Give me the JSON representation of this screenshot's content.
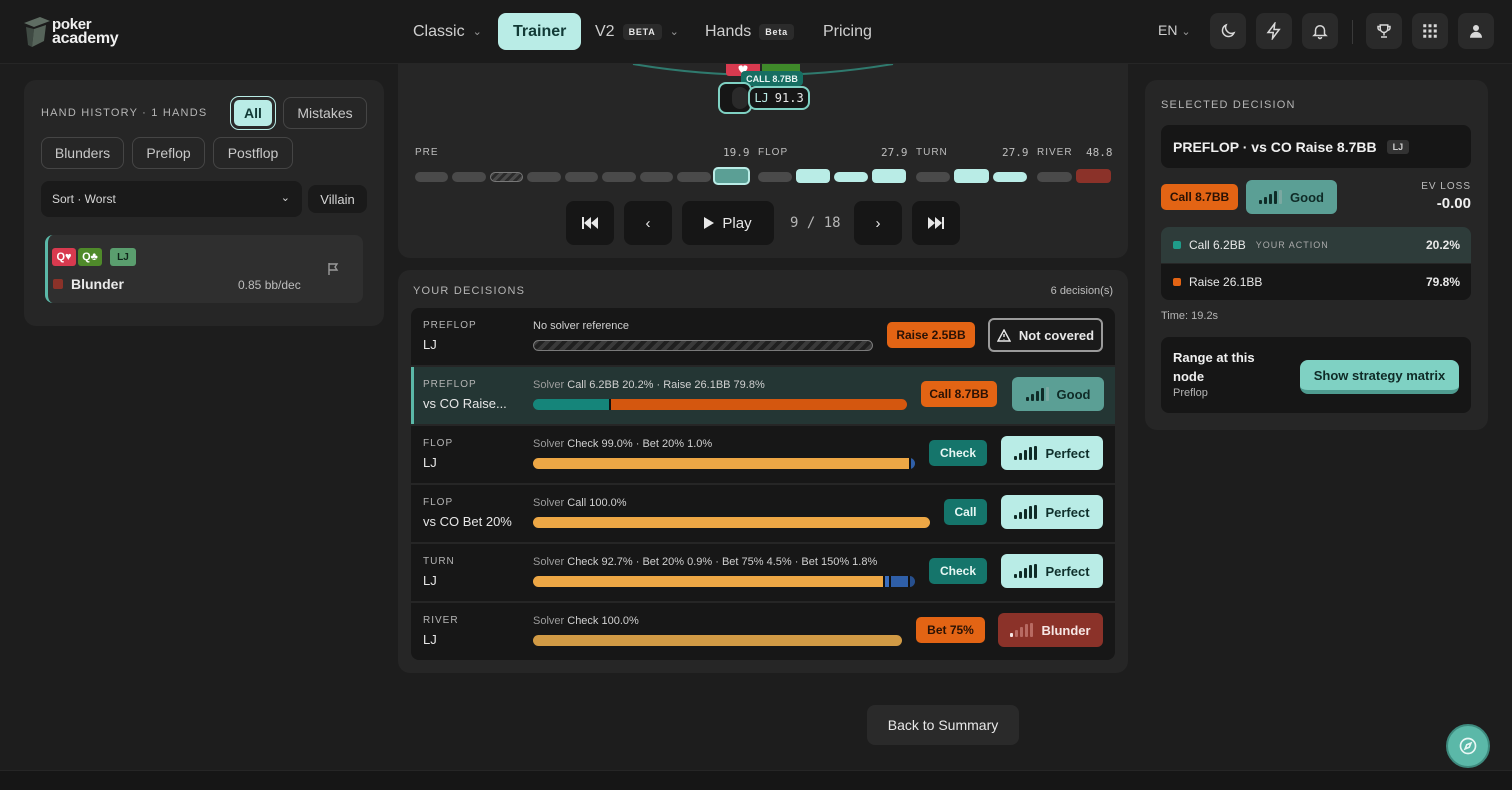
{
  "brand": {
    "line1": "poker",
    "line2": "academy"
  },
  "nav": {
    "classic": "Classic",
    "trainer": "Trainer",
    "v2": "V2",
    "v2_tag": "BETA",
    "hands": "Hands",
    "hands_tag": "Beta",
    "pricing": "Pricing",
    "lang": "EN"
  },
  "history": {
    "title": "HAND HISTORY · 1 HANDS",
    "filters": {
      "all": "All",
      "mistakes": "Mistakes",
      "blunders": "Blunders",
      "preflop": "Preflop",
      "postflop": "Postflop"
    },
    "sort": "Sort · Worst",
    "villain": "Villain",
    "hand": {
      "card1": "Q♥",
      "card2": "Q♣",
      "position": "LJ",
      "result": "Blunder",
      "score": "0.85 bb/dec",
      "card1_color": "#d83a4f",
      "card2_color": "#4f8a2a",
      "result_color": "#8b3229"
    }
  },
  "table": {
    "call_tag": "CALL 8.7BB",
    "seat_label": "LJ",
    "seat_stack": "91.3"
  },
  "timeline": {
    "pre": "PRE",
    "pre_val": "19.9",
    "flop": "FLOP",
    "flop_val": "27.9",
    "turn": "TURN",
    "turn_val": "27.9",
    "river": "RIVER",
    "river_val": "48.8"
  },
  "controls": {
    "play": "Play",
    "counter": "9 / 18"
  },
  "decisions": {
    "title": "YOUR DECISIONS",
    "count": "6 decision(s)",
    "solver_word": "Solver",
    "rows": [
      {
        "street": "PREFLOP",
        "spot": "LJ",
        "solver": "No solver reference",
        "action": "Raise 2.5BB",
        "grade": "Not covered"
      },
      {
        "street": "PREFLOP",
        "spot": "vs CO Raise...",
        "solver": "Call 6.2BB 20.2% · Raise 26.1BB 79.8%",
        "action": "Call 8.7BB",
        "grade": "Good"
      },
      {
        "street": "FLOP",
        "spot": "LJ",
        "solver": "Check 99.0% · Bet 20% 1.0%",
        "action": "Check",
        "grade": "Perfect"
      },
      {
        "street": "FLOP",
        "spot": "vs CO Bet 20%",
        "solver": "Call 100.0%",
        "action": "Call",
        "grade": "Perfect"
      },
      {
        "street": "TURN",
        "spot": "LJ",
        "solver": "Check 92.7% · Bet 20% 0.9% · Bet 75% 4.5% · Bet 150% 1.8%",
        "action": "Check",
        "grade": "Perfect"
      },
      {
        "street": "RIVER",
        "spot": "LJ",
        "solver": "Check 100.0%",
        "action": "Bet 75%",
        "grade": "Blunder"
      }
    ]
  },
  "selected": {
    "title": "SELECTED DECISION",
    "spot": "PREFLOP · vs CO Raise 8.7BB",
    "position": "LJ",
    "action": "Call 8.7BB",
    "grade": "Good",
    "ev_label": "EV LOSS",
    "ev_value": "-0.00",
    "options": [
      {
        "label": "Call 6.2BB",
        "tag": "YOUR ACTION",
        "pct": "20.2%",
        "color": "#1f9c8a"
      },
      {
        "label": "Raise 26.1BB",
        "tag": "",
        "pct": "79.8%",
        "color": "#e36414"
      }
    ],
    "time": "Time: 19.2s",
    "range_title": "Range at this node",
    "range_street": "Preflop",
    "show_matrix": "Show strategy matrix"
  },
  "back": "Back to Summary"
}
